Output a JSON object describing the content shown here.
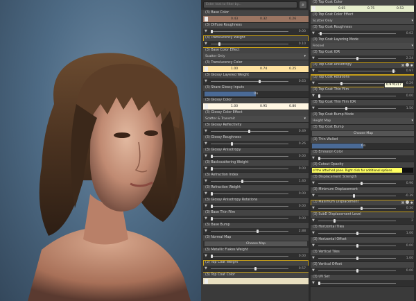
{
  "search": {
    "placeholder": "Enter text to filter by..."
  },
  "left_column": [
    {
      "kind": "color",
      "label": "(3) Base Color",
      "values": [
        "0.43",
        "0.32",
        "0.26"
      ],
      "bg": "#9b7562"
    },
    {
      "kind": "slider",
      "label": "(3) Diffuse Roughness",
      "value": "0.00",
      "pos": 0.0
    },
    {
      "kind": "slider",
      "label": "(3) Translucency Weight",
      "value": "0.10",
      "pos": 0.1,
      "selected": true
    },
    {
      "kind": "select",
      "label": "(3) Base Color Effect",
      "value": "Scatter Only"
    },
    {
      "kind": "color",
      "label": "(3) Translucency Color",
      "values": [
        "1.00",
        "0.74",
        "0.25"
      ],
      "bg": "#ffe2a0"
    },
    {
      "kind": "slider",
      "label": "(3) Glossy Layered Weight",
      "value": "0.63",
      "pos": 0.63
    },
    {
      "kind": "toggle",
      "label": "(3) Share Glossy Inputs",
      "value": "On"
    },
    {
      "kind": "color",
      "label": "(3) Glossy Color",
      "values": [
        "1.00",
        "0.95",
        "0.80"
      ],
      "bg": "#fff6e2"
    },
    {
      "kind": "select",
      "label": "(3) Glossy Color Effect",
      "value": "Scatter & Transmit"
    },
    {
      "kind": "slider",
      "label": "(3) Glossy Reflectivity",
      "value": "0.49",
      "pos": 0.49
    },
    {
      "kind": "slider",
      "label": "(3) Glossy Roughness",
      "value": "0.26",
      "pos": 0.26
    },
    {
      "kind": "slider",
      "label": "(3) Glossy Anisotropy",
      "value": "0.00",
      "pos": 0.0
    },
    {
      "kind": "slider",
      "label": "(3) Backscattering Weight",
      "value": "0.00",
      "pos": 0.0
    },
    {
      "kind": "slider",
      "label": "(3) Refraction Index",
      "value": "1.40",
      "pos": 0.4
    },
    {
      "kind": "slider",
      "label": "(3) Refraction Weight",
      "value": "0.00",
      "pos": 0.0
    },
    {
      "kind": "slider",
      "label": "(3) Glossy Anisotropy Rotations",
      "value": "0.00",
      "pos": 0.0
    },
    {
      "kind": "slider",
      "label": "(3) Base Thin Film",
      "value": "0.00",
      "pos": 0.0
    },
    {
      "kind": "slider",
      "label": "(3) Base Bump",
      "value": "2.88",
      "pos": 0.6
    },
    {
      "kind": "button",
      "label": "(3) Normal Map",
      "value": "Choose Map"
    },
    {
      "kind": "slider",
      "label": "(3) Metallic Flakes Weight",
      "value": "0.00",
      "pos": 0.0
    },
    {
      "kind": "slider",
      "label": "(3) Top Coat Weight",
      "value": "0.57",
      "pos": 0.57,
      "selected": true
    },
    {
      "kind": "color",
      "label": "(3) Top Coat Color",
      "values": [
        "",
        "",
        ""
      ],
      "bg": "#e8dfc0"
    }
  ],
  "right_column": [
    {
      "kind": "color",
      "label": "(3) Top Coat Color",
      "values": [
        "0.65",
        "0.75",
        "0.53"
      ],
      "bg": "#e6eecc"
    },
    {
      "kind": "select",
      "label": "(3) Top Coat Color Effect",
      "value": "Scatter Only"
    },
    {
      "kind": "slider",
      "label": "(3) Top Coat Roughness",
      "value": "0.02",
      "pos": 0.02
    },
    {
      "kind": "select",
      "label": "(3) Top Coat Layering Mode",
      "value": "Fresnel"
    },
    {
      "kind": "slider",
      "label": "(3) Top Coat IOR",
      "value": "2.24",
      "pos": 0.5
    },
    {
      "kind": "slider",
      "label": "(3) Top Coat Anisotropy",
      "value": "0.97",
      "pos": 0.97,
      "selected": true,
      "icons": true
    },
    {
      "kind": "slider",
      "label": "(3) Top Coat Rotations",
      "value": "0.29",
      "pos": 0.29,
      "selected": true
    },
    {
      "kind": "slider",
      "label": "(3) Top Coat Thin Film",
      "value": "0.00",
      "pos": 0.0
    },
    {
      "kind": "slider",
      "label": "(3) Top Coat Thin Film IOR",
      "value": "1.50",
      "pos": 0.35
    },
    {
      "kind": "select",
      "label": "(3) Top Coat Bump Mode",
      "value": "Height Map"
    },
    {
      "kind": "button",
      "label": "(3) Top Coat Bump",
      "value": "Choose Map"
    },
    {
      "kind": "toggle",
      "label": "(3) Thin Walled",
      "value": "On"
    },
    {
      "kind": "slider",
      "label": "(3) Emission Color",
      "value": "",
      "pos": 0.0
    },
    {
      "kind": "slider",
      "label": "(3) Cutout Opacity",
      "value": "1.15",
      "pos": 0.85
    },
    {
      "kind": "slider",
      "label": "(3) Displacement Strength",
      "value": "0.90",
      "pos": 0.55
    },
    {
      "kind": "slider",
      "label": "(3) Minimum Displacement",
      "value": "-0.39",
      "pos": 0.45
    },
    {
      "kind": "slider",
      "label": "(3) Maximum Displacement",
      "value": "0.30",
      "pos": 0.55,
      "selected": true,
      "icons": true
    },
    {
      "kind": "slider",
      "label": "(3) SubD Displacement Level",
      "value": "2",
      "pos": 0.2
    },
    {
      "kind": "slider",
      "label": "(3) Horizontal Tiles",
      "value": "1.00",
      "pos": 0.5
    },
    {
      "kind": "slider",
      "label": "(3) Horizontal Offset",
      "value": "0.00",
      "pos": 0.5
    },
    {
      "kind": "slider",
      "label": "(3) Vertical Tiles",
      "value": "1.00",
      "pos": 0.5
    },
    {
      "kind": "slider",
      "label": "(3) Vertical Offset",
      "value": "0.00",
      "pos": 0.5
    },
    {
      "kind": "slider",
      "label": "(3) UV Set",
      "value": "",
      "pos": 0.0
    }
  ],
  "tooltips": {
    "rotation_value": "0.970317",
    "emission": "of the attached pane. Right click for additional options."
  }
}
